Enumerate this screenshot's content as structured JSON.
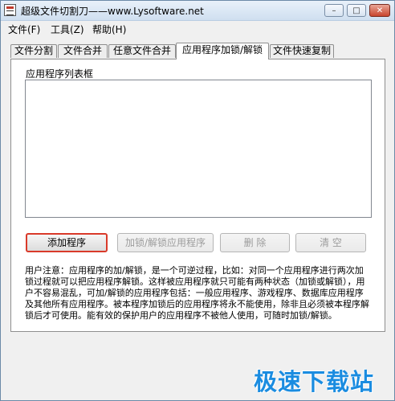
{
  "window": {
    "title": "超级文件切割刀——www.Lysoftware.net",
    "controls": {
      "minimize": "–",
      "maximize": "□",
      "close": "✕"
    }
  },
  "menu": [
    "文件(F)",
    "工具(Z)",
    "帮助(H)"
  ],
  "tabs": [
    {
      "label": "文件分割",
      "active": false
    },
    {
      "label": "文件合并",
      "active": false
    },
    {
      "label": "任意文件合并",
      "active": false
    },
    {
      "label": "应用程序加锁/解锁",
      "active": true
    },
    {
      "label": "文件快速复制",
      "active": false
    }
  ],
  "panel": {
    "list_label": "应用程序列表框",
    "buttons": {
      "add": "添加程序",
      "lock": "加锁/解锁应用程序",
      "delete": "删 除",
      "clear": "清 空"
    },
    "notice": "用户注意：应用程序的加/解锁，是一个可逆过程，比如：对同一个应用程序进行两次加锁过程就可以把应用程序解锁。这样被应用程序就只可能有两种状态（加锁或解锁），用户不容易混乱，可加/解锁的应用程序包括：一般应用程序、游戏程序、数据库应用程序及其他所有应用程序。被本程序加锁后的应用程序将永不能使用，除非且必须被本程序解锁后才可使用。能有效的保护用户的应用程序不被他人使用，可随时加锁/解锁。"
  },
  "watermark": "极速下载站",
  "colors": {
    "highlight_border": "#d93a2a",
    "watermark": "#1a8ce0"
  }
}
